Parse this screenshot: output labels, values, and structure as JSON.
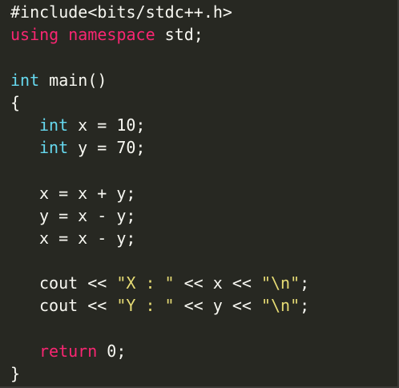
{
  "editor": {
    "lines": [
      {
        "tokens": [
          {
            "t": "#include<bits/stdc++.h>",
            "c": "plain"
          }
        ]
      },
      {
        "tokens": [
          {
            "t": "using",
            "c": "kw-pink"
          },
          {
            "t": " ",
            "c": "plain"
          },
          {
            "t": "namespace",
            "c": "kw-pink"
          },
          {
            "t": " std;",
            "c": "plain"
          }
        ]
      },
      {
        "tokens": []
      },
      {
        "tokens": [
          {
            "t": "int",
            "c": "kw-type"
          },
          {
            "t": " main()",
            "c": "plain"
          }
        ]
      },
      {
        "tokens": [
          {
            "t": "{",
            "c": "plain"
          }
        ]
      },
      {
        "indent": true,
        "tokens": [
          {
            "t": "int",
            "c": "kw-type"
          },
          {
            "t": " x = 10;",
            "c": "plain"
          }
        ]
      },
      {
        "indent": true,
        "tokens": [
          {
            "t": "int",
            "c": "kw-type"
          },
          {
            "t": " y = 70;",
            "c": "plain"
          }
        ]
      },
      {
        "tokens": []
      },
      {
        "indent": true,
        "tokens": [
          {
            "t": "x = x + y;",
            "c": "plain"
          }
        ]
      },
      {
        "indent": true,
        "tokens": [
          {
            "t": "y = x - y;",
            "c": "plain"
          }
        ]
      },
      {
        "indent": true,
        "tokens": [
          {
            "t": "x = x - y;",
            "c": "plain"
          }
        ]
      },
      {
        "tokens": []
      },
      {
        "indent": true,
        "tokens": [
          {
            "t": "cout << ",
            "c": "plain"
          },
          {
            "t": "\"X : \"",
            "c": "str"
          },
          {
            "t": " << x << ",
            "c": "plain"
          },
          {
            "t": "\"\\n\"",
            "c": "str"
          },
          {
            "t": ";",
            "c": "plain"
          }
        ]
      },
      {
        "indent": true,
        "tokens": [
          {
            "t": "cout << ",
            "c": "plain"
          },
          {
            "t": "\"Y : \"",
            "c": "str"
          },
          {
            "t": " << y << ",
            "c": "plain"
          },
          {
            "t": "\"\\n\"",
            "c": "str"
          },
          {
            "t": ";",
            "c": "plain"
          }
        ]
      },
      {
        "tokens": []
      },
      {
        "indent": true,
        "tokens": [
          {
            "t": "return",
            "c": "kw-pink"
          },
          {
            "t": " 0;",
            "c": "plain"
          }
        ]
      },
      {
        "tokens": [
          {
            "t": "}",
            "c": "plain"
          }
        ]
      }
    ]
  },
  "theme": {
    "background": "#272822",
    "text": "#f8f8f2",
    "keyword": "#f92672",
    "type": "#66d9ef",
    "string": "#e6db74"
  }
}
